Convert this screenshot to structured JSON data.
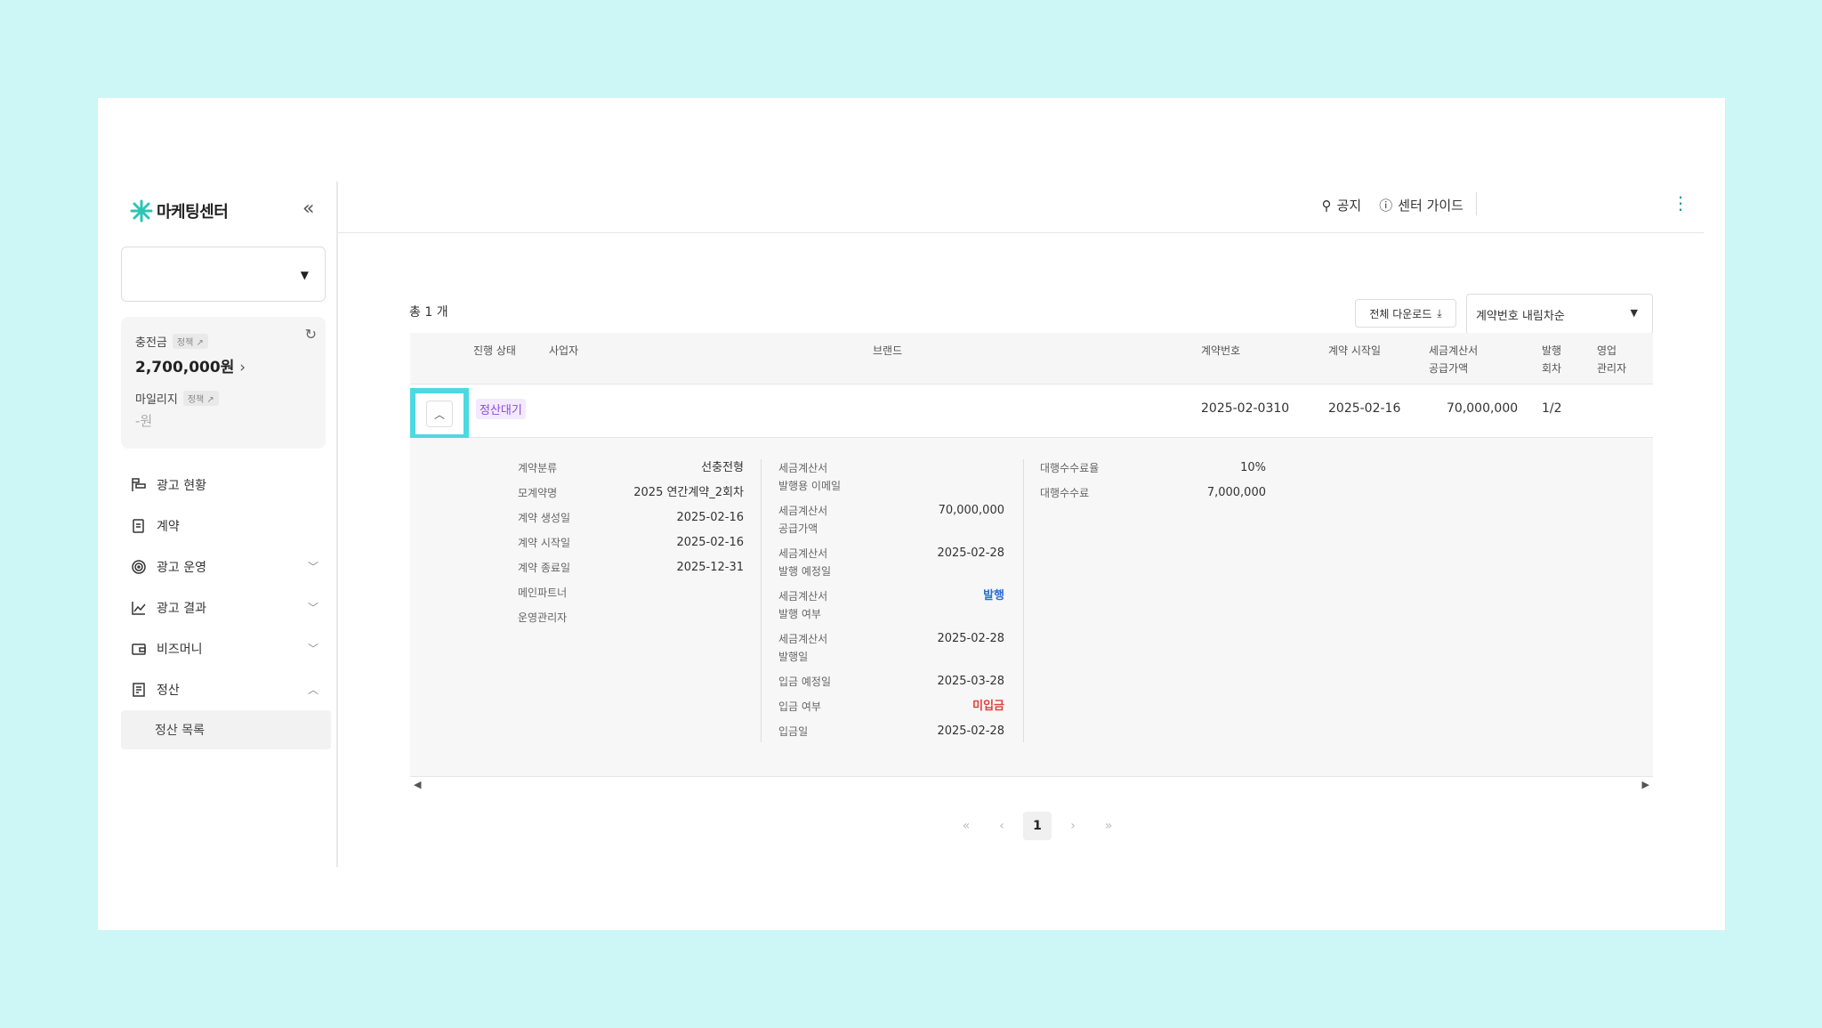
{
  "brand": {
    "name": "마케팅센터",
    "accent": "#2ec4b6"
  },
  "sidebar": {
    "account_select_value": "",
    "charge_label": "충전금",
    "charge_tag": "정책 ↗",
    "charge_amount": "2,700,000원",
    "mileage_label": "마일리지",
    "mileage_tag": "정책 ↗",
    "mileage_amount": "-원",
    "items": [
      {
        "label": "광고 현황",
        "icon": "ad-status-icon",
        "chevron": ""
      },
      {
        "label": "계약",
        "icon": "contract-icon",
        "chevron": ""
      },
      {
        "label": "광고 운영",
        "icon": "target-icon",
        "chevron": "down"
      },
      {
        "label": "광고 결과",
        "icon": "chart-icon",
        "chevron": "down"
      },
      {
        "label": "비즈머니",
        "icon": "wallet-icon",
        "chevron": "down"
      },
      {
        "label": "정산",
        "icon": "receipt-icon",
        "chevron": "up"
      }
    ],
    "sub_item": "정산 목록"
  },
  "header": {
    "notice": "공지",
    "guide": "센터 가이드"
  },
  "list": {
    "total": "총 1 개",
    "download": "전체 다운로드",
    "sort": "계약번호 내림차순"
  },
  "table": {
    "headers": {
      "status": "진행 상태",
      "business": "사업자",
      "brand": "브랜드",
      "contract_no": "계약번호",
      "start": "계약 시작일",
      "amount": "세금계산서\n공급가액",
      "issue_round": "발행\n회차",
      "manager": "영업\n관리자"
    },
    "row": {
      "status": "정산대기",
      "contract_no": "2025-02-0310",
      "start": "2025-02-16",
      "amount": "70,000,000",
      "issue_round": "1/2"
    },
    "detail": {
      "col1": [
        {
          "k": "계약분류",
          "v": "선충전형"
        },
        {
          "k": "모계약명",
          "v": "2025 연간계약_2회차"
        },
        {
          "k": "계약 생성일",
          "v": "2025-02-16"
        },
        {
          "k": "계약 시작일",
          "v": "2025-02-16"
        },
        {
          "k": "계약 종료일",
          "v": "2025-12-31"
        },
        {
          "k": "메인파트너",
          "v": ""
        },
        {
          "k": "운영관리자",
          "v": ""
        }
      ],
      "col2": [
        {
          "k": "세금계산서\n발행용 이메일",
          "v": ""
        },
        {
          "k": "세금계산서\n공급가액",
          "v": "70,000,000"
        },
        {
          "k": "세금계산서\n발행 예정일",
          "v": "2025-02-28"
        },
        {
          "k": "세금계산서\n발행 여부",
          "v": "발행"
        },
        {
          "k": "세금계산서\n발행일",
          "v": "2025-02-28"
        },
        {
          "k": "입금 예정일",
          "v": "2025-03-28"
        },
        {
          "k": "입금 여부",
          "v": "미입금"
        },
        {
          "k": "입금일",
          "v": "2025-02-28"
        }
      ],
      "col3": [
        {
          "k": "대행수수료율",
          "v": "10%"
        },
        {
          "k": "대행수수료",
          "v": "7,000,000"
        }
      ]
    }
  },
  "pagination": {
    "current": "1"
  }
}
